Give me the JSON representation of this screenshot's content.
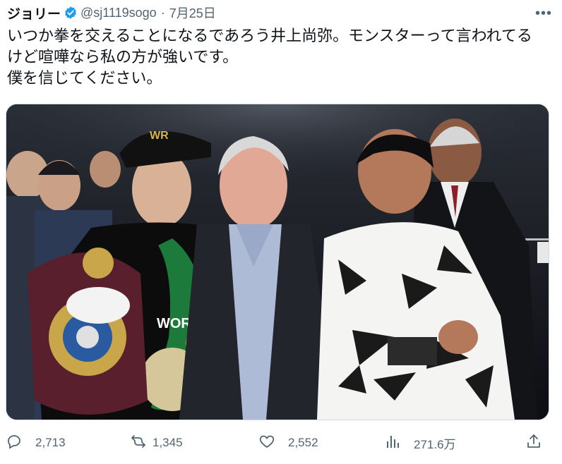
{
  "tweet": {
    "display_name": "ジョリー",
    "handle": "@sj1119sogo",
    "separator": "·",
    "date": "7月25日",
    "more_label": "•••",
    "text": "いつか拳を交えることになるであろう井上尚弥。モンスターって言われてる\nけど喧嘩なら私の方が強いです。\n僕を信じてください。"
  },
  "media": {
    "belt_text": "WORLD",
    "cap_text": "WR"
  },
  "actions": {
    "replies": "2,713",
    "retweets": "1,345",
    "likes": "2,552",
    "views": "271.6万"
  },
  "colors": {
    "verified": "#1d9bf0",
    "muted": "#536471"
  }
}
